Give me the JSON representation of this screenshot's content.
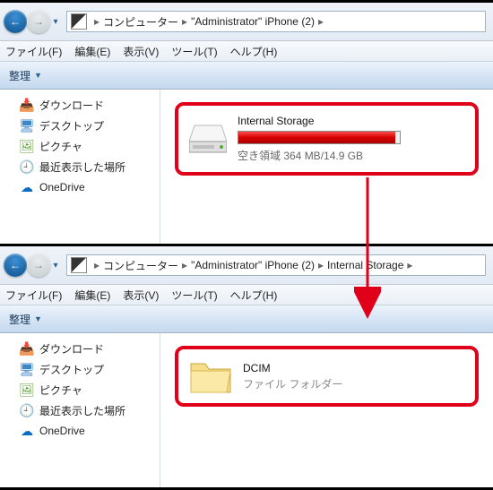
{
  "nav": {
    "back_glyph": "←",
    "fwd_glyph": "→",
    "dd_glyph": "▾"
  },
  "addr1": {
    "computer": "コンピューター",
    "device": "\"Administrator\"     iPhone (2)",
    "sep": "▸"
  },
  "addr2": {
    "computer": "コンピューター",
    "device": "\"Administrator\"     iPhone (2)",
    "storage": "Internal Storage",
    "sep": "▸"
  },
  "menu": {
    "file": "ファイル(F)",
    "edit": "編集(E)",
    "view": "表示(V)",
    "tools": "ツール(T)",
    "help": "ヘルプ(H)"
  },
  "toolbar": {
    "organize": "整理",
    "dd": "▼"
  },
  "sidebar": {
    "items": [
      {
        "label": "ダウンロード",
        "glyph": "📥",
        "cls": "ico-downloads"
      },
      {
        "label": "デスクトップ",
        "glyph": "🖥",
        "cls": "ico-desktop"
      },
      {
        "label": "ピクチャ",
        "glyph": "🖼",
        "cls": "ico-pictures"
      },
      {
        "label": "最近表示した場所",
        "glyph": "🕘",
        "cls": "ico-recent"
      },
      {
        "label": "OneDrive",
        "glyph": "☁",
        "cls": "ico-onedrive"
      }
    ]
  },
  "drive": {
    "name": "Internal Storage",
    "capacity_text": "空き領域 364 MB/14.9 GB",
    "fill_percent": 97
  },
  "folder": {
    "name": "DCIM",
    "type": "ファイル フォルダー"
  }
}
